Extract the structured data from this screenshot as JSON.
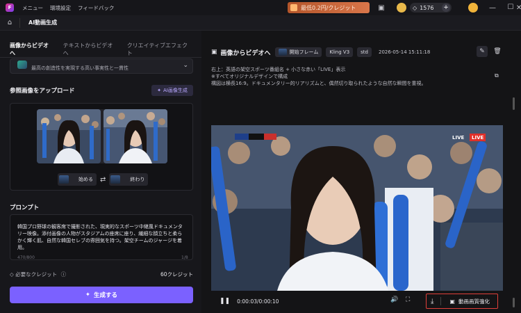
{
  "titlebar": {
    "menu": [
      "メニュー",
      "環境設定",
      "フィードバック"
    ],
    "promo": "最低0.2円/クレジット",
    "credits": "1576"
  },
  "subbar": {
    "crumb": "AI動画生成"
  },
  "left": {
    "tabs": [
      "画像からビデオへ",
      "テキストからビデオへ",
      "クリエイティブエフェクト"
    ],
    "model_desc": "最高の創造性を実現する高い事実性と一貫性",
    "ref_title": "参照画像をアップロード",
    "ai_gen_label": "AI画像生成",
    "start_label": "始める",
    "end_label": "終わり",
    "prompt_title": "プロンプト",
    "prompt_text": "韓国プロ野球の観客席で撮影された、現実的なスポーツ中継風ドキュメンタリー映像。添付画像の人物がスタジアムの座席に座り、繊細な顔立ちと柔らかく輝く肌、自然な韓国セレブの雰囲気を持つ。架空チームのジャージを着用。",
    "prompt_footer": "470/800",
    "prompt_counter": "1/8",
    "credit_label": "必要なクレジット",
    "credit_value": "60クレジット",
    "generate_label": "生成する"
  },
  "right": {
    "title": "画像からビデオへ",
    "tag_frame": "開始フレーム",
    "tag_model": "Kling V3",
    "tag_mode": "std",
    "date": "2026-05-14 15:11:18",
    "note1": "右上：英語の架空スポーツ番組名 + 小さな赤い「LIVE」表示",
    "note2": "※すべてオリジナルデザインで構成",
    "note3": "構図は横長16:9。ドキュメンタリー的リアリズムと、偶然切り取られたような自然な瞬間を重視。",
    "live1": "LIVE",
    "live2": "LIVE",
    "time": "0:00:03/0:00:10",
    "enhance_label": "動画画質強化"
  },
  "colors": {
    "accent": "#7b61ff",
    "highlight_border": "#e0403a",
    "live_red": "#e0302a"
  }
}
